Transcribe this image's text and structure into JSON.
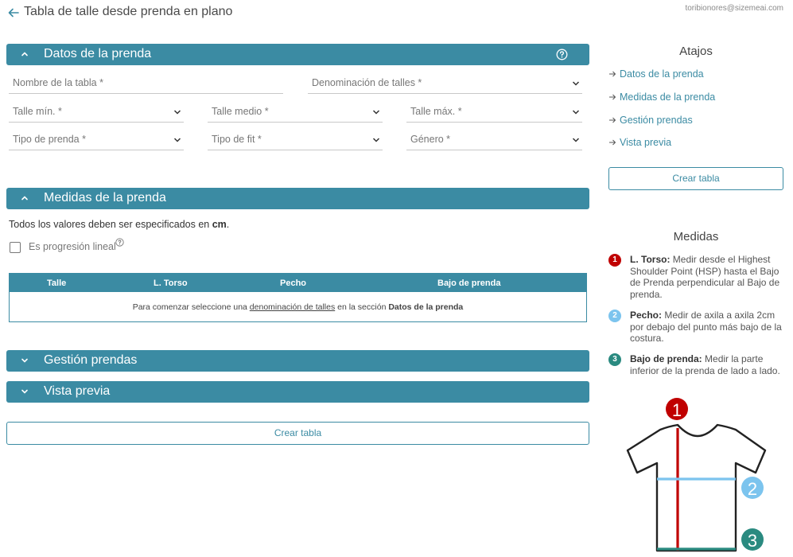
{
  "header": {
    "title": "Tabla de talle desde prenda en plano",
    "user_email": "toribionores@sizemeai.com"
  },
  "sections": {
    "datos": {
      "label": "Datos de la prenda"
    },
    "medidas": {
      "label": "Medidas de la prenda"
    },
    "gestion": {
      "label": "Gestión prendas"
    },
    "vista": {
      "label": "Vista previa"
    }
  },
  "form": {
    "nombre_tabla": "Nombre de la tabla *",
    "denominacion": "Denominación de talles *",
    "talle_min": "Talle mín. *",
    "talle_medio": "Talle medio *",
    "talle_max": "Talle máx. *",
    "tipo_prenda": "Tipo de prenda *",
    "tipo_fit": "Tipo de fit *",
    "genero": "Género *"
  },
  "medidas_panel": {
    "note_prefix": "Todos los valores deben ser especificados en ",
    "note_unit": "cm",
    "note_suffix": ".",
    "progresion_label": "Es progresión lineal",
    "table": {
      "headers": [
        "Talle",
        "L. Torso",
        "Pecho",
        "Bajo de prenda"
      ],
      "empty_prefix": "Para comenzar seleccione una ",
      "empty_link": "denominación de talles",
      "empty_middle": " en la sección ",
      "empty_section": "Datos de la prenda"
    }
  },
  "actions": {
    "crear_tabla": "Crear tabla"
  },
  "sidebar": {
    "shortcuts_title": "Atajos",
    "shortcuts": [
      "Datos de la prenda",
      "Medidas de la prenda",
      "Gestión prendas",
      "Vista previa"
    ],
    "crear_tabla": "Crear tabla",
    "medidas_title": "Medidas",
    "measures": [
      {
        "num": "1",
        "name": "L. Torso:",
        "desc": " Medir desde el Highest Shoulder Point (HSP) hasta el Bajo de Prenda perpendicular al Bajo de prenda.",
        "color": "#c00000"
      },
      {
        "num": "2",
        "name": "Pecho:",
        "desc": " Medir de axila a axila 2cm por debajo del punto más bajo de la costura.",
        "color": "#7cc4ee"
      },
      {
        "num": "3",
        "name": "Bajo de prenda:",
        "desc": " Medir la parte inferior de la prenda de lado a lado.",
        "color": "#2a8a80"
      }
    ],
    "diagram_numbers": [
      "1",
      "2",
      "3"
    ]
  },
  "colors": {
    "accent": "#3b8ba3"
  }
}
